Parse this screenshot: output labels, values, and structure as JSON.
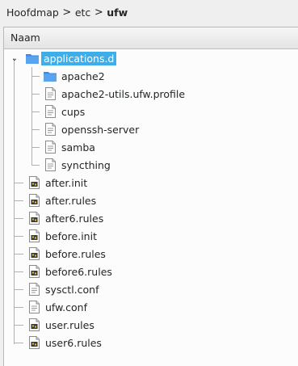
{
  "breadcrumb": {
    "items": [
      "Hoofdmap",
      "etc",
      "ufw"
    ],
    "separator": ">"
  },
  "header": {
    "column_label": "Naam"
  },
  "tree": {
    "selected": "applications.d",
    "root": {
      "label": "applications.d",
      "icon": "folder-icon",
      "expanded": true,
      "children": [
        {
          "label": "apache2",
          "icon": "folder-icon"
        },
        {
          "label": "apache2-utils.ufw.profile",
          "icon": "text-file-icon"
        },
        {
          "label": "cups",
          "icon": "text-file-icon"
        },
        {
          "label": "openssh-server",
          "icon": "text-file-icon"
        },
        {
          "label": "samba",
          "icon": "text-file-icon"
        },
        {
          "label": "syncthing",
          "icon": "text-file-icon"
        }
      ]
    },
    "files": [
      {
        "label": "after.init",
        "icon": "script-file-icon"
      },
      {
        "label": "after.rules",
        "icon": "script-file-icon"
      },
      {
        "label": "after6.rules",
        "icon": "script-file-icon"
      },
      {
        "label": "before.init",
        "icon": "script-file-icon"
      },
      {
        "label": "before.rules",
        "icon": "script-file-icon"
      },
      {
        "label": "before6.rules",
        "icon": "script-file-icon"
      },
      {
        "label": "sysctl.conf",
        "icon": "text-file-icon"
      },
      {
        "label": "ufw.conf",
        "icon": "text-file-icon"
      },
      {
        "label": "user.rules",
        "icon": "script-file-icon"
      },
      {
        "label": "user6.rules",
        "icon": "script-file-icon"
      }
    ]
  },
  "colors": {
    "selection": "#3daee9",
    "folder": "#3f8ae2",
    "tree_line": "#b0b0b0"
  }
}
